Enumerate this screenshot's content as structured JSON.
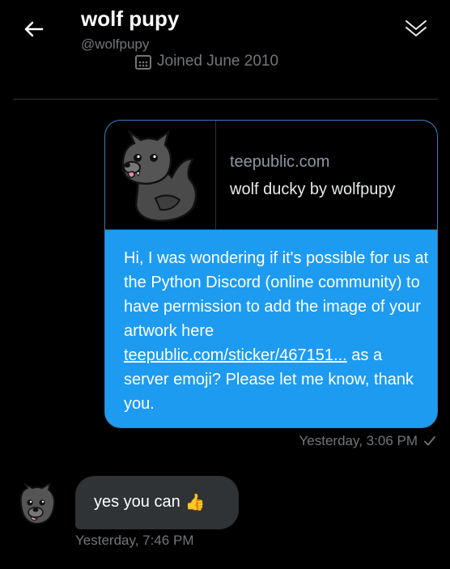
{
  "header": {
    "title": "wolf pupy",
    "handle": "@wolfpupy",
    "joined": "Joined June 2010"
  },
  "link_card": {
    "domain": "teepublic.com",
    "title": "wolf ducky by wolfpupy"
  },
  "sent_message": {
    "text_before_link": "Hi, I was wondering if it's possible for us at the Python Discord (online community) to have permission to add the image of your artwork here ",
    "link_text": "teepublic.com/sticker/467151...",
    "text_after_link": " as a server emoji? Please let me know, thank you.",
    "timestamp": "Yesterday, 3:06 PM"
  },
  "received_message": {
    "text": "yes you can",
    "emoji": "👍",
    "timestamp": "Yesterday, 7:46 PM"
  },
  "icons": {
    "back": "arrow-left-icon",
    "collapse": "double-chevron-down-icon",
    "calendar": "calendar-icon",
    "read_receipt": "checkmark-icon"
  },
  "colors": {
    "background": "#000000",
    "sent_bubble": "#1d9bf0",
    "received_bubble": "#2f3336",
    "muted_text": "#71767b"
  }
}
